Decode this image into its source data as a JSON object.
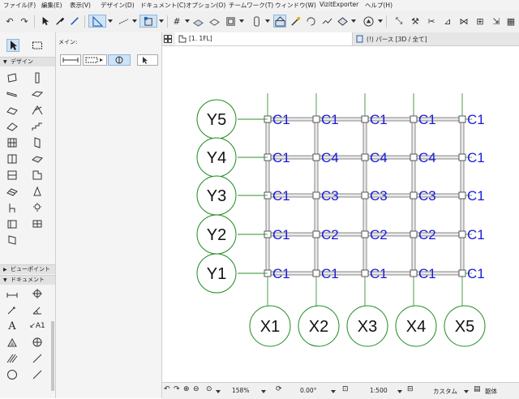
{
  "menubar": {
    "items": [
      "ファイル(F)",
      "編集(E)",
      "表示(V)",
      "デザイン(D)",
      "ドキュメント(C)",
      "オプション(O)",
      "チームワーク(T)",
      "ウィンドウ(W)",
      "VizitExporter",
      "ヘルプ(H)"
    ]
  },
  "toolbar": {
    "icons": [
      "undo-icon",
      "redo-icon",
      "pointer-icon",
      "eyedropper-icon",
      "inject-icon",
      "guide-icon",
      "snap-icon",
      "snap-points-icon",
      "grid-icon",
      "trace-icon",
      "gravity-icon",
      "layers-icon",
      "pen-set-icon",
      "floor-plan-icon",
      "magic-wand-icon",
      "sun-icon",
      "section-icon",
      "navigator-icon"
    ]
  },
  "palette": {
    "selection_tools": [
      "arrow-tool",
      "marquee-tool"
    ],
    "info_label": "メイン:",
    "design_section": "デザイン",
    "viewpoint_section": "ビューポイント",
    "document_section": "ドキュメント"
  },
  "tabs": [
    {
      "label": "[1. 1FL]",
      "icon": "floor-plan-icon",
      "active": true
    },
    {
      "label": "(!) パース [3D / 全て]",
      "icon": "3d-view-icon",
      "active": false
    }
  ],
  "grid": {
    "x_labels": [
      "X1",
      "X2",
      "X3",
      "X4",
      "X5"
    ],
    "y_labels": [
      "Y5",
      "Y4",
      "Y3",
      "Y2",
      "Y1"
    ],
    "column_labels": [
      [
        "C1",
        "C1",
        "C1",
        "C1",
        "C1"
      ],
      [
        "C1",
        "C4",
        "C4",
        "C4",
        "C1"
      ],
      [
        "C1",
        "C3",
        "C3",
        "C3",
        "C1"
      ],
      [
        "C1",
        "C2",
        "C2",
        "C2",
        "C1"
      ],
      [
        "C1",
        "C1",
        "C1",
        "C1",
        "C1"
      ]
    ],
    "bubble_color": "#1e8a1e",
    "label_color": "#1a1adc",
    "beam_color": "#5a5a5a"
  },
  "statusbar": {
    "zoom": "158%",
    "angle": "0.00°",
    "scale": "1:500",
    "display": "カスタム",
    "structure": "躯体"
  }
}
